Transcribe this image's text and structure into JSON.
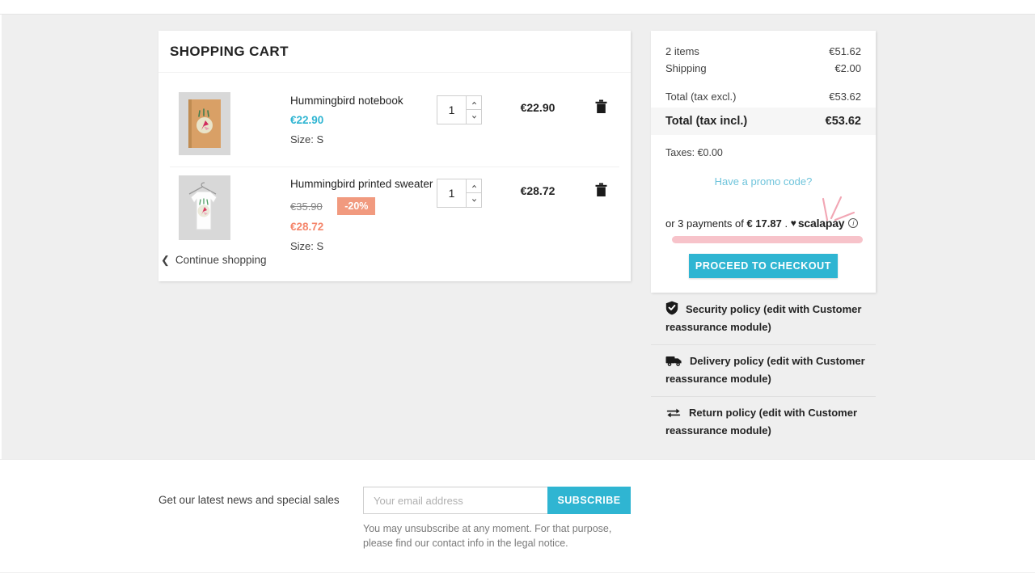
{
  "cart": {
    "title": "SHOPPING CART",
    "items": [
      {
        "name": "Hummingbird notebook",
        "price": "€22.90",
        "old_price": "",
        "discount_badge": "",
        "attribute": "Size: S",
        "qty": "1",
        "line_total": "€22.90",
        "thumb": "notebook-thumbnail",
        "remove_label": "trash-icon"
      },
      {
        "name": "Hummingbird printed sweater",
        "price": "€28.72",
        "old_price": "€35.90",
        "discount_badge": "-20%",
        "attribute": "Size: S",
        "qty": "1",
        "line_total": "€28.72",
        "thumb": "sweater-thumbnail",
        "remove_label": "trash-icon"
      }
    ],
    "continue_shopping": "Continue shopping"
  },
  "summary": {
    "items_label": "2 items",
    "items_value": "€51.62",
    "shipping_label": "Shipping",
    "shipping_value": "€2.00",
    "total_excl_label": "Total (tax excl.)",
    "total_excl_value": "€53.62",
    "total_incl_label": "Total (tax incl.)",
    "total_incl_value": "€53.62",
    "taxes": "Taxes: €0.00",
    "promo_link": "Have a promo code?",
    "checkout_label": "PROCEED TO CHECKOUT"
  },
  "scalapay": {
    "prefix": "or 3 payments of",
    "amount": "€ 17.87",
    "separator": ".",
    "heart": "♥",
    "brand": "scalapay",
    "info": "i"
  },
  "reassurance": [
    {
      "icon": "shield-check-icon",
      "text": "Security policy (edit with Customer reassurance module)"
    },
    {
      "icon": "delivery-truck-icon",
      "text": "Delivery policy (edit with Customer reassurance module)"
    },
    {
      "icon": "return-arrows-icon",
      "text": "Return policy (edit with Customer reassurance module)"
    }
  ],
  "newsletter": {
    "label": "Get our latest news and special sales",
    "placeholder": "Your email address",
    "value": "",
    "button": "SUBSCRIBE",
    "note": "You may unsubscribe at any moment. For that purpose, please find our contact info in the legal notice."
  },
  "colors": {
    "accent": "#2fb5d2",
    "price_blue": "#2fb5d2",
    "discount_orange": "#f19a7f",
    "sale_price": "#f5866b",
    "scalapay_pink": "#f7c3ca",
    "body_bg": "#efefef"
  }
}
